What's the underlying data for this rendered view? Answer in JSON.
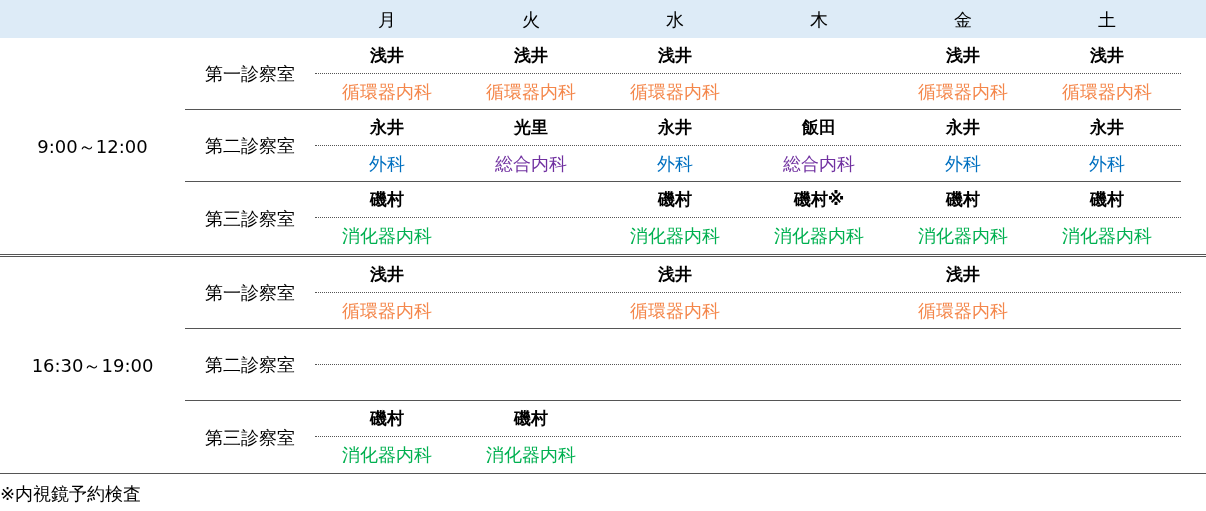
{
  "days": [
    "月",
    "火",
    "水",
    "木",
    "金",
    "土"
  ],
  "sessions": [
    {
      "time": "9:00～12:00",
      "rooms": [
        {
          "name": "第一診察室",
          "slots": [
            {
              "kind": "shift",
              "doctor": "浅井",
              "department": "循環器内科",
              "color": "#f4874b"
            },
            {
              "kind": "shift",
              "doctor": "浅井",
              "department": "循環器内科",
              "color": "#f4874b"
            },
            {
              "kind": "shift",
              "doctor": "浅井",
              "department": "循環器内科",
              "color": "#f4874b"
            },
            {
              "kind": "empty"
            },
            {
              "kind": "shift",
              "doctor": "浅井",
              "department": "循環器内科",
              "color": "#f4874b"
            },
            {
              "kind": "shift",
              "doctor": "浅井",
              "department": "循環器内科",
              "color": "#f4874b"
            }
          ]
        },
        {
          "name": "第二診察室",
          "slots": [
            {
              "kind": "shift",
              "doctor": "永井",
              "department": "外科",
              "color": "#0070c0"
            },
            {
              "kind": "shift",
              "doctor": "光里",
              "department": "総合内科",
              "color": "#7030a0"
            },
            {
              "kind": "shift",
              "doctor": "永井",
              "department": "外科",
              "color": "#0070c0"
            },
            {
              "kind": "shift",
              "doctor": "飯田",
              "department": "総合内科",
              "color": "#7030a0"
            },
            {
              "kind": "shift",
              "doctor": "永井",
              "department": "外科",
              "color": "#0070c0"
            },
            {
              "kind": "shift",
              "doctor": "永井",
              "department": "外科",
              "color": "#0070c0"
            }
          ]
        },
        {
          "name": "第三診察室",
          "slots": [
            {
              "kind": "shift",
              "doctor": "磯村",
              "department": "消化器内科",
              "color": "#00b050"
            },
            {
              "kind": "empty"
            },
            {
              "kind": "shift",
              "doctor": "磯村",
              "department": "消化器内科",
              "color": "#00b050"
            },
            {
              "kind": "shift",
              "doctor": "磯村※",
              "department": "消化器内科",
              "color": "#00b050"
            },
            {
              "kind": "shift",
              "doctor": "磯村",
              "department": "消化器内科",
              "color": "#00b050"
            },
            {
              "kind": "shift",
              "doctor": "磯村",
              "department": "消化器内科",
              "color": "#00b050"
            }
          ]
        }
      ]
    },
    {
      "time": "16:30～19:00",
      "rooms": [
        {
          "name": "第一診察室",
          "slots": [
            {
              "kind": "shift",
              "doctor": "浅井",
              "department": "循環器内科",
              "color": "#f4874b"
            },
            {
              "kind": "empty"
            },
            {
              "kind": "shift",
              "doctor": "浅井",
              "department": "循環器内科",
              "color": "#f4874b"
            },
            {
              "kind": "empty"
            },
            {
              "kind": "shift",
              "doctor": "浅井",
              "department": "循環器内科",
              "color": "#f4874b"
            },
            {
              "kind": "empty"
            }
          ]
        },
        {
          "name": "第二診察室",
          "slots": [
            {
              "kind": "empty"
            },
            {
              "kind": "empty"
            },
            {
              "kind": "empty"
            },
            {
              "kind": "empty"
            },
            {
              "kind": "empty"
            },
            {
              "kind": "empty"
            }
          ]
        },
        {
          "name": "第三診察室",
          "slots": [
            {
              "kind": "shift",
              "doctor": "磯村",
              "department": "消化器内科",
              "color": "#00b050"
            },
            {
              "kind": "shift",
              "doctor": "磯村",
              "department": "消化器内科",
              "color": "#00b050"
            },
            {
              "kind": "empty"
            },
            {
              "kind": "empty"
            },
            {
              "kind": "empty"
            },
            {
              "kind": "empty"
            }
          ]
        }
      ]
    }
  ],
  "footnote": "※内視鏡予約検査"
}
